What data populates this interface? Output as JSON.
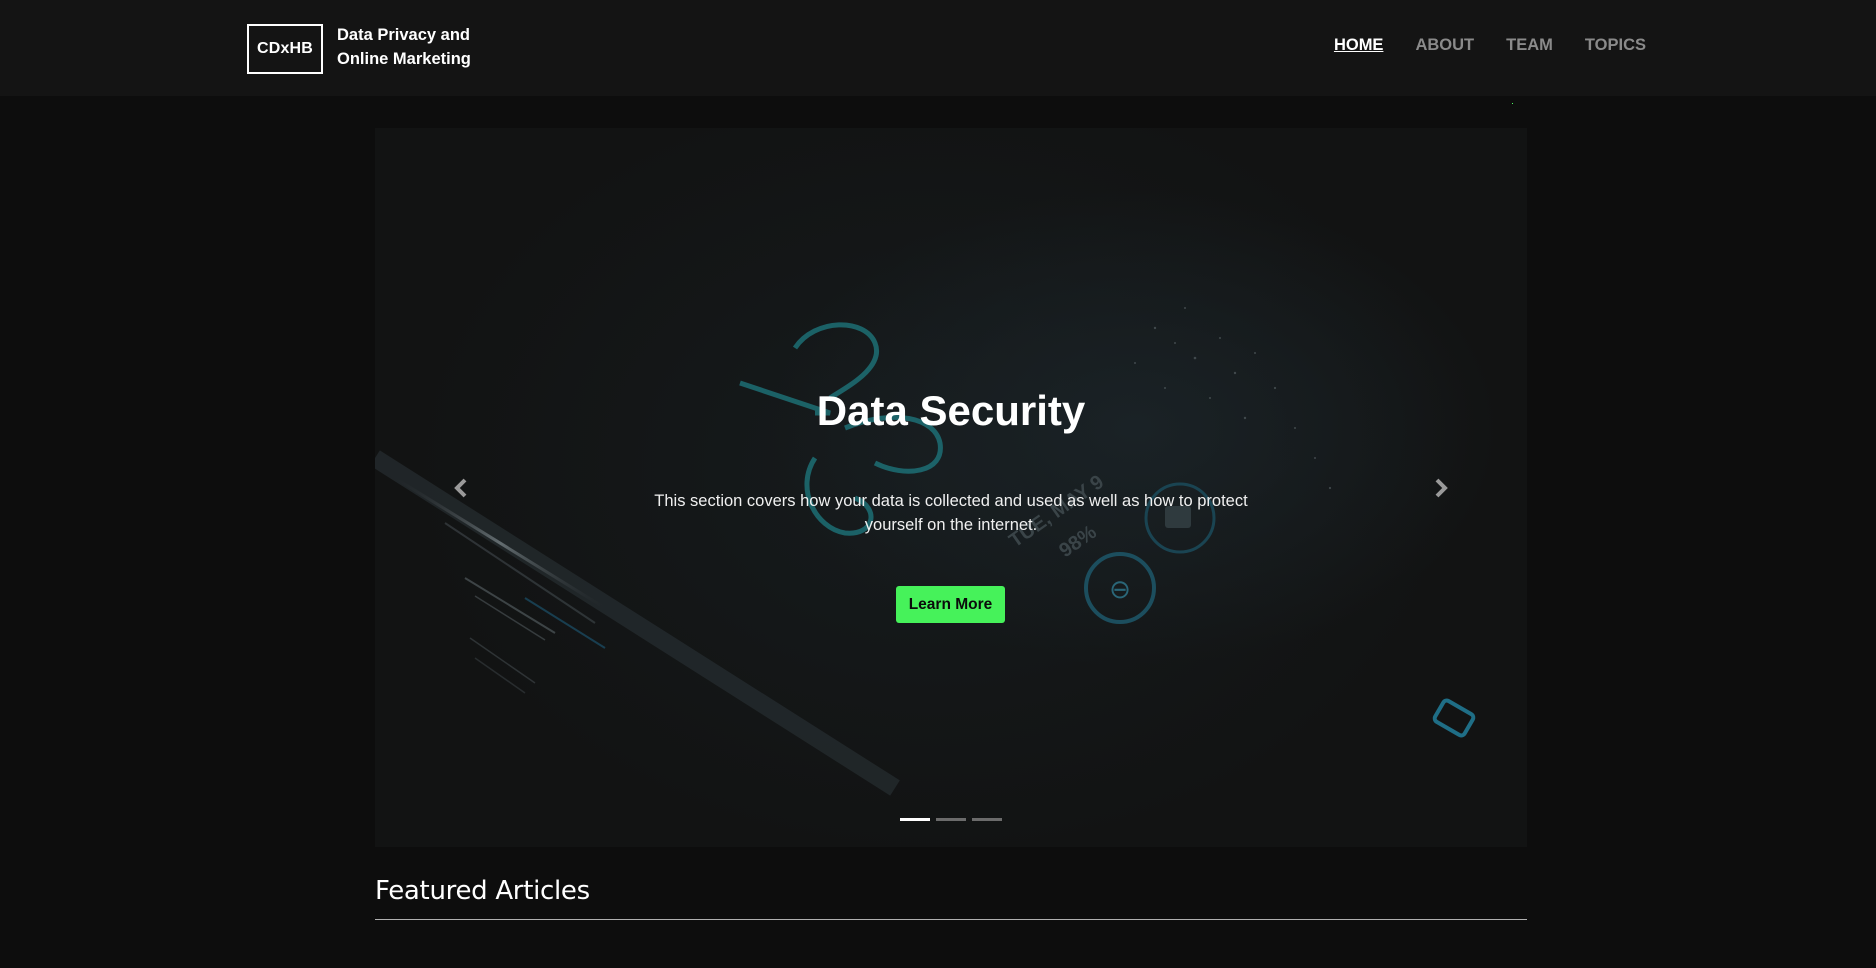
{
  "brand": {
    "logo_text": "CDxHB",
    "site_title_line1": "Data Privacy and",
    "site_title_line2": "Online Marketing"
  },
  "nav": {
    "items": [
      {
        "label": "HOME",
        "active": true
      },
      {
        "label": "ABOUT",
        "active": false
      },
      {
        "label": "TEAM",
        "active": false
      },
      {
        "label": "TOPICS",
        "active": false
      }
    ]
  },
  "hero": {
    "title": "Data Security",
    "description": "This section covers how your data is collected and used as well as how to protect yourself on the internet.",
    "button_label": "Learn More",
    "prev_icon": "chevron-left-icon",
    "next_icon": "chevron-right-icon",
    "slide_count": 3,
    "active_slide": 1
  },
  "featured": {
    "heading": "Featured Articles"
  },
  "colors": {
    "accent": "#46f25a",
    "background": "#0d0d0d",
    "navbar": "#141414",
    "nav_inactive": "#8a8a8a"
  }
}
